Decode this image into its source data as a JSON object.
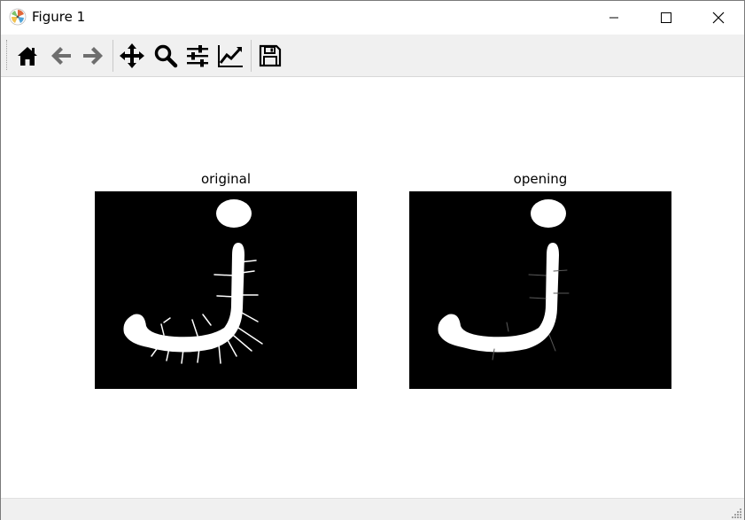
{
  "window": {
    "title": "Figure 1"
  },
  "toolbar": {
    "items": [
      {
        "name": "home-button",
        "icon": "home-icon"
      },
      {
        "name": "back-button",
        "icon": "arrow-left-icon"
      },
      {
        "name": "forward-button",
        "icon": "arrow-right-icon"
      },
      {
        "name": "pan-button",
        "icon": "move-icon"
      },
      {
        "name": "zoom-button",
        "icon": "magnifier-icon"
      },
      {
        "name": "configure-subplots-button",
        "icon": "sliders-icon"
      },
      {
        "name": "edit-axes-button",
        "icon": "line-chart-icon"
      },
      {
        "name": "save-button",
        "icon": "floppy-disk-icon"
      }
    ]
  },
  "figure": {
    "subplots": [
      {
        "title": "original"
      },
      {
        "title": "opening"
      }
    ]
  },
  "colors": {
    "toolbar_bg": "#f0f0f0",
    "image_bg": "#000000",
    "image_fg": "#ffffff"
  }
}
